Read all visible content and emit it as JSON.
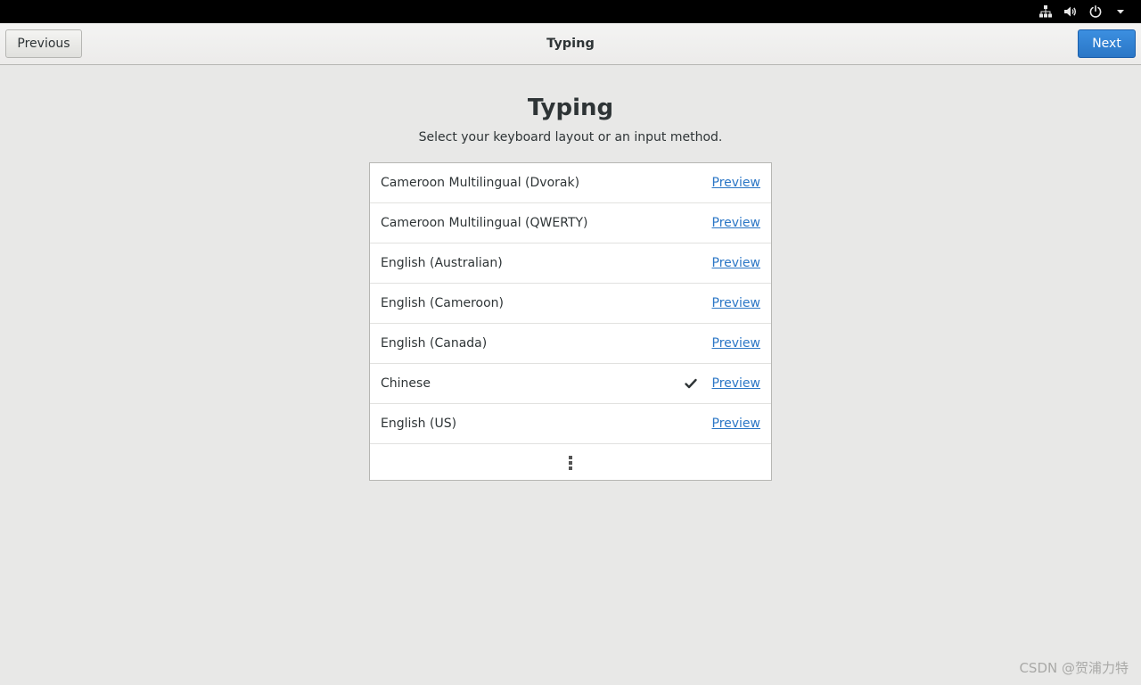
{
  "topbar": {
    "icons": [
      "network-wired-icon",
      "volume-icon",
      "power-icon",
      "caret-down-icon"
    ]
  },
  "header": {
    "title": "Typing",
    "previous_label": "Previous",
    "next_label": "Next"
  },
  "main": {
    "heading": "Typing",
    "subtitle": "Select your keyboard layout or an input method.",
    "items": [
      {
        "label": "Cameroon Multilingual (Dvorak)",
        "selected": false,
        "preview": "Preview"
      },
      {
        "label": "Cameroon Multilingual (QWERTY)",
        "selected": false,
        "preview": "Preview"
      },
      {
        "label": "English (Australian)",
        "selected": false,
        "preview": "Preview"
      },
      {
        "label": "English (Cameroon)",
        "selected": false,
        "preview": "Preview"
      },
      {
        "label": "English (Canada)",
        "selected": false,
        "preview": "Preview"
      },
      {
        "label": "Chinese",
        "selected": true,
        "preview": "Preview"
      },
      {
        "label": "English (US)",
        "selected": false,
        "preview": "Preview"
      }
    ],
    "more_icon": "vertical-ellipsis-icon"
  },
  "watermark": "CSDN @贺浦力特",
  "colors": {
    "topbar": "#000000",
    "accent": "#2a76c6",
    "background": "#e8e8e7"
  }
}
